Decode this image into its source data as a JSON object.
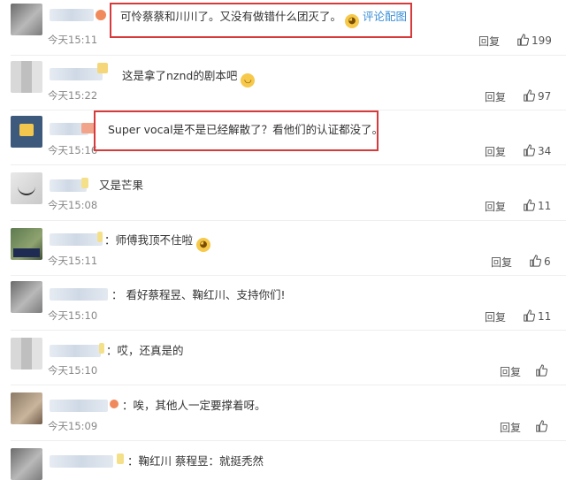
{
  "comments": [
    {
      "content": "可怜蔡蔡和川川了。又没有做错什么团灭了。",
      "emoji": "😸",
      "image_link": "评论配图",
      "time": "今天15:11",
      "reply_label": "回复",
      "likes": "199"
    },
    {
      "content": "这是拿了nznd的剧本吧",
      "emoji": "😂",
      "time": "今天15:22",
      "reply_label": "回复",
      "likes": "97"
    },
    {
      "content": "Super vocal是不是已经解散了？看他们的认证都没了。",
      "time": "今天15:16",
      "reply_label": "回复",
      "likes": "34"
    },
    {
      "content": "又是芒果",
      "time": "今天15:08",
      "reply_label": "回复",
      "likes": "11"
    },
    {
      "content": "：师傅我顶不住啦",
      "emoji": "😸",
      "time": "今天15:11",
      "reply_label": "回复",
      "likes": "6"
    },
    {
      "content": "：  看好蔡程昱、鞠红川、支持你们!",
      "time": "今天15:10",
      "reply_label": "回复",
      "likes": "11"
    },
    {
      "content": "：哎，还真是的",
      "time": "今天15:10",
      "reply_label": "回复"
    },
    {
      "content": "：唉，其他人一定要撑着呀。",
      "time": "今天15:09",
      "reply_label": "回复"
    },
    {
      "content": "：鞠红川 蔡程昱：就挺秃然"
    }
  ]
}
